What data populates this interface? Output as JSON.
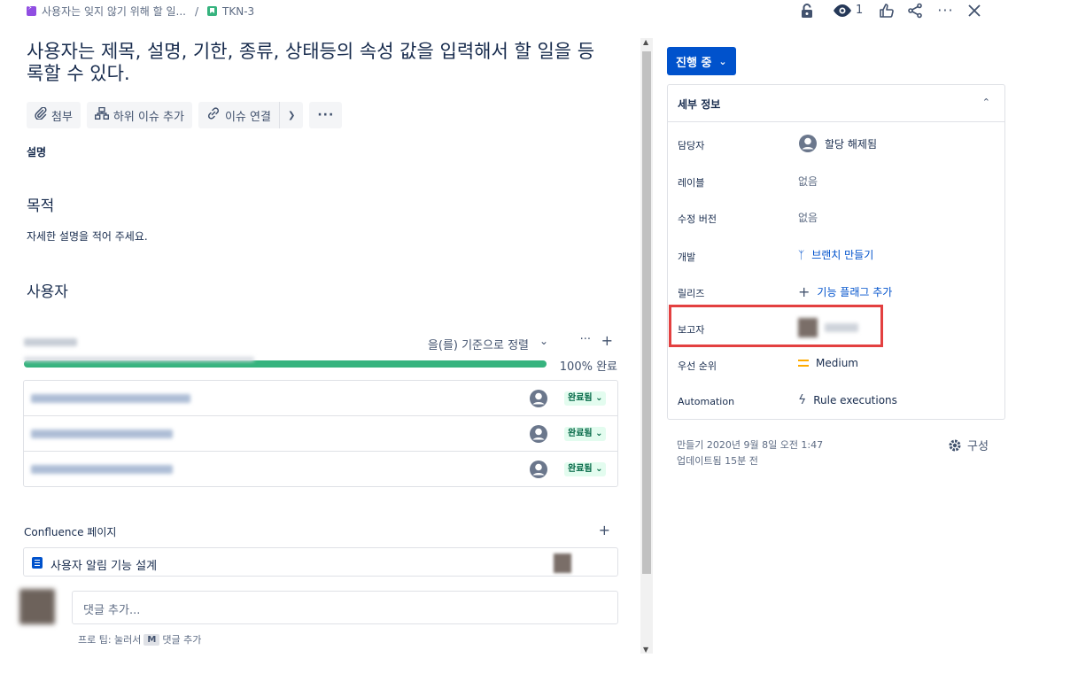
{
  "breadcrumb": {
    "epic": "사용자는 잊지 않기 위해 할 일...",
    "separator": "/",
    "issue_key": "TKN-3"
  },
  "topbar": {
    "watch_count": "1",
    "icons": [
      "lock-icon",
      "eye-icon",
      "thumbs-up-icon",
      "share-icon",
      "more-icon",
      "close-icon"
    ]
  },
  "issue": {
    "title": "사용자는 제목, 설명, 기한, 종류, 상태등의 속성 값을 입력해서 할 일을 등록할 수 있다."
  },
  "actions": {
    "attach": "첨부",
    "add_child": "하위 이슈 추가",
    "link_issue": "이슈 연결"
  },
  "description": {
    "label": "설명",
    "heading_purpose": "목적",
    "text": "자세한 설명을 적어 주세요.",
    "heading_user": "사용자"
  },
  "child_issues": {
    "sort_label": "을(를) 기준으로 정렬",
    "progress_percent": 100,
    "progress_label": "100% 완료",
    "rows": [
      {
        "status": "완료됨"
      },
      {
        "status": "완료됨"
      },
      {
        "status": "완료됨"
      }
    ]
  },
  "confluence": {
    "heading": "Confluence 페이지",
    "page_title": "사용자 알림 기능 설계"
  },
  "comment": {
    "placeholder": "댓글 추가...",
    "protip_prefix": "프로 팁: 눌러서",
    "protip_key": "M",
    "protip_suffix": "댓글 추가"
  },
  "sidebar": {
    "status": "진행 중",
    "details_title": "세부 정보",
    "fields": {
      "assignee_label": "담당자",
      "assignee_value": "할당 해제됨",
      "labels_label": "레이블",
      "labels_value": "없음",
      "fix_version_label": "수정 버전",
      "fix_version_value": "없음",
      "development_label": "개발",
      "development_value": "브랜치 만들기",
      "release_label": "릴리즈",
      "release_value": "기능 플래그 추가",
      "reporter_label": "보고자",
      "priority_label": "우선 순위",
      "priority_value": "Medium",
      "automation_label": "Automation",
      "automation_value": "Rule executions"
    },
    "created": "만들기 2020년 9월 8일 오전 1:47",
    "updated": "업데이트됨 15분 전",
    "configure": "구성"
  },
  "colors": {
    "primary": "#0052cc",
    "progress": "#36b37e",
    "done_badge_bg": "#e3fcef",
    "done_badge_text": "#006644",
    "priority_medium": "#ffab00",
    "highlight_box": "#e34040"
  }
}
